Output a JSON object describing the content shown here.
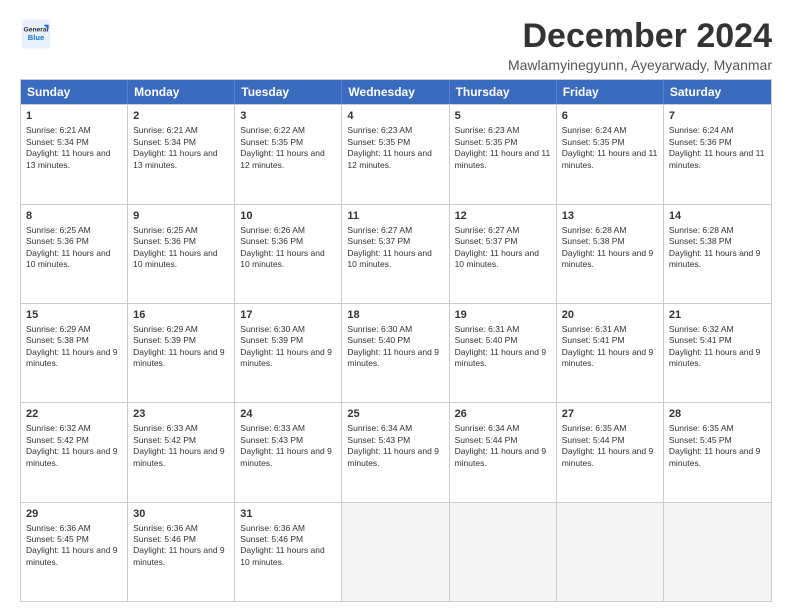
{
  "logo": {
    "line1": "General",
    "line2": "Blue"
  },
  "title": "December 2024",
  "subtitle": "Mawlamyinegyunn, Ayeyarwady, Myanmar",
  "header_days": [
    "Sunday",
    "Monday",
    "Tuesday",
    "Wednesday",
    "Thursday",
    "Friday",
    "Saturday"
  ],
  "weeks": [
    [
      {
        "day": "1",
        "rise": "Sunrise: 6:21 AM",
        "set": "Sunset: 5:34 PM",
        "daylight": "Daylight: 11 hours and 13 minutes."
      },
      {
        "day": "2",
        "rise": "Sunrise: 6:21 AM",
        "set": "Sunset: 5:34 PM",
        "daylight": "Daylight: 11 hours and 13 minutes."
      },
      {
        "day": "3",
        "rise": "Sunrise: 6:22 AM",
        "set": "Sunset: 5:35 PM",
        "daylight": "Daylight: 11 hours and 12 minutes."
      },
      {
        "day": "4",
        "rise": "Sunrise: 6:23 AM",
        "set": "Sunset: 5:35 PM",
        "daylight": "Daylight: 11 hours and 12 minutes."
      },
      {
        "day": "5",
        "rise": "Sunrise: 6:23 AM",
        "set": "Sunset: 5:35 PM",
        "daylight": "Daylight: 11 hours and 11 minutes."
      },
      {
        "day": "6",
        "rise": "Sunrise: 6:24 AM",
        "set": "Sunset: 5:35 PM",
        "daylight": "Daylight: 11 hours and 11 minutes."
      },
      {
        "day": "7",
        "rise": "Sunrise: 6:24 AM",
        "set": "Sunset: 5:36 PM",
        "daylight": "Daylight: 11 hours and 11 minutes."
      }
    ],
    [
      {
        "day": "8",
        "rise": "Sunrise: 6:25 AM",
        "set": "Sunset: 5:36 PM",
        "daylight": "Daylight: 11 hours and 10 minutes."
      },
      {
        "day": "9",
        "rise": "Sunrise: 6:25 AM",
        "set": "Sunset: 5:36 PM",
        "daylight": "Daylight: 11 hours and 10 minutes."
      },
      {
        "day": "10",
        "rise": "Sunrise: 6:26 AM",
        "set": "Sunset: 5:36 PM",
        "daylight": "Daylight: 11 hours and 10 minutes."
      },
      {
        "day": "11",
        "rise": "Sunrise: 6:27 AM",
        "set": "Sunset: 5:37 PM",
        "daylight": "Daylight: 11 hours and 10 minutes."
      },
      {
        "day": "12",
        "rise": "Sunrise: 6:27 AM",
        "set": "Sunset: 5:37 PM",
        "daylight": "Daylight: 11 hours and 10 minutes."
      },
      {
        "day": "13",
        "rise": "Sunrise: 6:28 AM",
        "set": "Sunset: 5:38 PM",
        "daylight": "Daylight: 11 hours and 9 minutes."
      },
      {
        "day": "14",
        "rise": "Sunrise: 6:28 AM",
        "set": "Sunset: 5:38 PM",
        "daylight": "Daylight: 11 hours and 9 minutes."
      }
    ],
    [
      {
        "day": "15",
        "rise": "Sunrise: 6:29 AM",
        "set": "Sunset: 5:38 PM",
        "daylight": "Daylight: 11 hours and 9 minutes."
      },
      {
        "day": "16",
        "rise": "Sunrise: 6:29 AM",
        "set": "Sunset: 5:39 PM",
        "daylight": "Daylight: 11 hours and 9 minutes."
      },
      {
        "day": "17",
        "rise": "Sunrise: 6:30 AM",
        "set": "Sunset: 5:39 PM",
        "daylight": "Daylight: 11 hours and 9 minutes."
      },
      {
        "day": "18",
        "rise": "Sunrise: 6:30 AM",
        "set": "Sunset: 5:40 PM",
        "daylight": "Daylight: 11 hours and 9 minutes."
      },
      {
        "day": "19",
        "rise": "Sunrise: 6:31 AM",
        "set": "Sunset: 5:40 PM",
        "daylight": "Daylight: 11 hours and 9 minutes."
      },
      {
        "day": "20",
        "rise": "Sunrise: 6:31 AM",
        "set": "Sunset: 5:41 PM",
        "daylight": "Daylight: 11 hours and 9 minutes."
      },
      {
        "day": "21",
        "rise": "Sunrise: 6:32 AM",
        "set": "Sunset: 5:41 PM",
        "daylight": "Daylight: 11 hours and 9 minutes."
      }
    ],
    [
      {
        "day": "22",
        "rise": "Sunrise: 6:32 AM",
        "set": "Sunset: 5:42 PM",
        "daylight": "Daylight: 11 hours and 9 minutes."
      },
      {
        "day": "23",
        "rise": "Sunrise: 6:33 AM",
        "set": "Sunset: 5:42 PM",
        "daylight": "Daylight: 11 hours and 9 minutes."
      },
      {
        "day": "24",
        "rise": "Sunrise: 6:33 AM",
        "set": "Sunset: 5:43 PM",
        "daylight": "Daylight: 11 hours and 9 minutes."
      },
      {
        "day": "25",
        "rise": "Sunrise: 6:34 AM",
        "set": "Sunset: 5:43 PM",
        "daylight": "Daylight: 11 hours and 9 minutes."
      },
      {
        "day": "26",
        "rise": "Sunrise: 6:34 AM",
        "set": "Sunset: 5:44 PM",
        "daylight": "Daylight: 11 hours and 9 minutes."
      },
      {
        "day": "27",
        "rise": "Sunrise: 6:35 AM",
        "set": "Sunset: 5:44 PM",
        "daylight": "Daylight: 11 hours and 9 minutes."
      },
      {
        "day": "28",
        "rise": "Sunrise: 6:35 AM",
        "set": "Sunset: 5:45 PM",
        "daylight": "Daylight: 11 hours and 9 minutes."
      }
    ],
    [
      {
        "day": "29",
        "rise": "Sunrise: 6:36 AM",
        "set": "Sunset: 5:45 PM",
        "daylight": "Daylight: 11 hours and 9 minutes."
      },
      {
        "day": "30",
        "rise": "Sunrise: 6:36 AM",
        "set": "Sunset: 5:46 PM",
        "daylight": "Daylight: 11 hours and 9 minutes."
      },
      {
        "day": "31",
        "rise": "Sunrise: 6:36 AM",
        "set": "Sunset: 5:46 PM",
        "daylight": "Daylight: 11 hours and 10 minutes."
      },
      null,
      null,
      null,
      null
    ]
  ]
}
